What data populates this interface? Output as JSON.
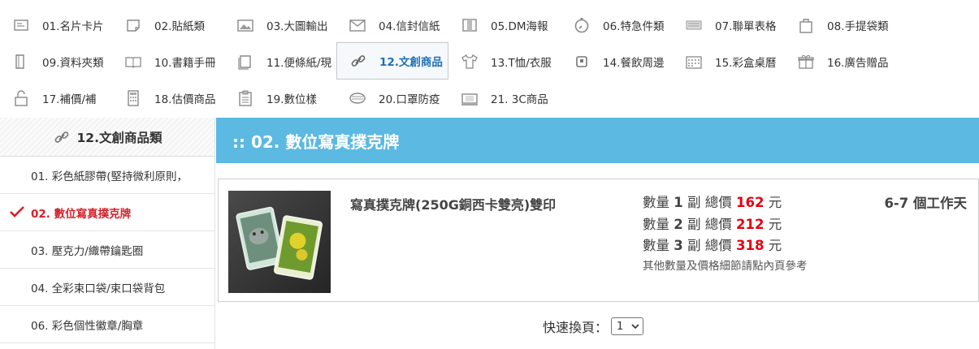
{
  "categories": [
    [
      {
        "label": "01.名片卡片",
        "icon": "card-icon"
      },
      {
        "label": "02.貼紙類",
        "icon": "sticker-icon"
      },
      {
        "label": "03.大圖輸出",
        "icon": "picture-icon"
      },
      {
        "label": "04.信封信紙",
        "icon": "envelope-icon"
      },
      {
        "label": "05.DM海報",
        "icon": "brochure-icon"
      },
      {
        "label": "06.特急件類",
        "icon": "stopwatch-icon"
      },
      {
        "label": "07.聯單表格",
        "icon": "form-icon"
      },
      {
        "label": "08.手提袋類",
        "icon": "bag-icon"
      }
    ],
    [
      {
        "label": "09.資料夾類",
        "icon": "folder-icon"
      },
      {
        "label": "10.書籍手冊",
        "icon": "book-icon"
      },
      {
        "label": "11.便條紙/現",
        "icon": "notepad-icon"
      },
      {
        "label": "12.文創商品",
        "icon": "keychain-icon"
      },
      {
        "label": "13.T恤/衣服",
        "icon": "tshirt-icon"
      },
      {
        "label": "14.餐飲周邊",
        "icon": "cup-icon"
      },
      {
        "label": "15.彩盒桌曆",
        "icon": "calendar-icon"
      },
      {
        "label": "16.廣告贈品",
        "icon": "gift-icon"
      }
    ],
    [
      {
        "label": "17.補價/補",
        "icon": "lock-icon"
      },
      {
        "label": "18.估價商品",
        "icon": "calculator-icon"
      },
      {
        "label": "19.數位樣",
        "icon": "clipboard-icon"
      },
      {
        "label": "20.口罩防疫",
        "icon": "mask-icon"
      },
      {
        "label": "21. 3C商品",
        "icon": "device-icon"
      }
    ]
  ],
  "active_category": "12.文創商品",
  "sidebar": {
    "title": "12.文創商品類",
    "items": [
      {
        "label": "01. 彩色紙膠帶(堅持微利原則，"
      },
      {
        "label": "02. 數位寫真撲克牌"
      },
      {
        "label": "03. 壓克力/織帶鑰匙圈"
      },
      {
        "label": "04. 全彩束口袋/束口袋背包"
      },
      {
        "label": "06. 彩色個性徽章/胸章"
      }
    ]
  },
  "main": {
    "banner_title": ":: 02. 數位寫真撲克牌"
  },
  "product": {
    "name": "寫真撲克牌(250G銅西卡雙亮)雙印",
    "qty_label": "數量",
    "unit": "副",
    "total_label": "總價",
    "currency": "元",
    "price_rows": [
      {
        "qty": "1",
        "price": "162"
      },
      {
        "qty": "2",
        "price": "212"
      },
      {
        "qty": "3",
        "price": "318"
      }
    ],
    "note": "其他數量及價格細節請點內頁參考",
    "days_num": "6-7",
    "days_label": "個工作天"
  },
  "pager": {
    "label": "快速換頁：",
    "selected": "1"
  },
  "colors": {
    "banner": "#5bb9e2",
    "price": "#e60012",
    "active_link": "#1e6fb8",
    "active_side": "#d6202a"
  }
}
